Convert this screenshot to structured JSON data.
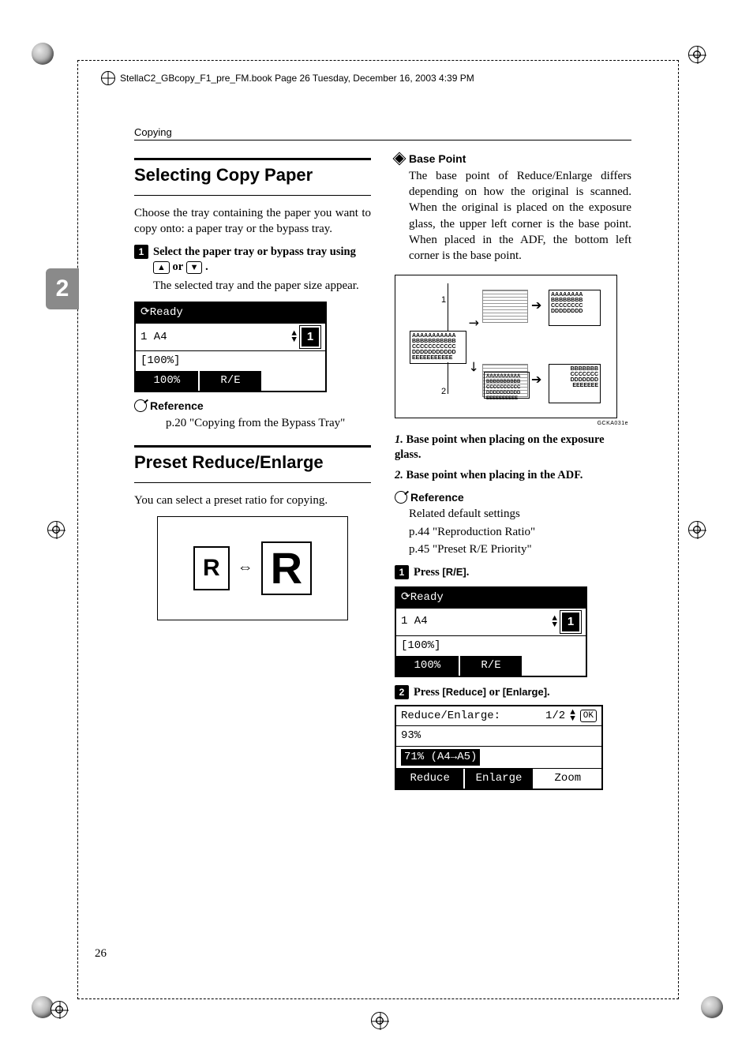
{
  "running_head": "StellaC2_GBcopy_F1_pre_FM.book  Page 26  Tuesday, December 16, 2003  4:39 PM",
  "section_label": "Copying",
  "side_tab": "2",
  "page_number": "26",
  "left": {
    "h1": "Selecting Copy Paper",
    "intro": "Choose the tray containing the paper you want to copy onto: a paper tray or the bypass tray.",
    "step1_pre": "Select the paper tray or bypass tray using ",
    "step1_or": " or ",
    "step1_post": ".",
    "key_up": "▲",
    "key_down": "▼",
    "step1_result": "The selected tray and the paper size appear.",
    "lcd": {
      "ready": "Ready",
      "tray": "1   A4",
      "ratio": "[100%]",
      "foot_left": "100%",
      "foot_mid": "R/E",
      "badge": "1"
    },
    "ref_label": "Reference",
    "ref_text": "p.20 \"Copying from the Bypass Tray\"",
    "h2": "Preset Reduce/Enlarge",
    "h2_intro": "You can select a preset ratio for copying.",
    "r_small": "R",
    "r_big": "R",
    "dbl_arrow": "⇔"
  },
  "right": {
    "bp_label": "Base Point",
    "bp_text": "The base point of Reduce/Enlarge differs depending on how the original is scanned. When the original is placed on the exposure glass, the upper left corner is the base point. When placed in the ADF, the bottom left corner is the base point.",
    "fig_caption": "GCKA031e",
    "note1_num": "1.",
    "note1": "Base point when placing on the exposure glass.",
    "note2_num": "2.",
    "note2": "Base point when placing in the ADF.",
    "ref_label": "Reference",
    "ref_lines": [
      "Related default settings",
      "p.44 \"Reproduction Ratio\"",
      "p.45 \"Preset R/E Priority\""
    ],
    "stepA_pre": "Press ",
    "stepA_key": "[R/E]",
    "stepA_post": ".",
    "lcdA": {
      "ready": "Ready",
      "tray": "1   A4",
      "ratio": "[100%]",
      "foot_left": "100%",
      "foot_mid": "R/E",
      "badge": "1"
    },
    "stepB_pre": "Press ",
    "stepB_k1": "[Reduce]",
    "stepB_mid": " or ",
    "stepB_k2": "[Enlarge]",
    "stepB_post": ".",
    "lcdB": {
      "title_l": "Reduce/Enlarge:",
      "title_r": "1/2",
      "ok": "OK",
      "opt1": "93%",
      "opt2": "71% (A4→A5)",
      "foot1": "Reduce",
      "foot2": "Enlarge",
      "foot3": "Zoom"
    }
  }
}
